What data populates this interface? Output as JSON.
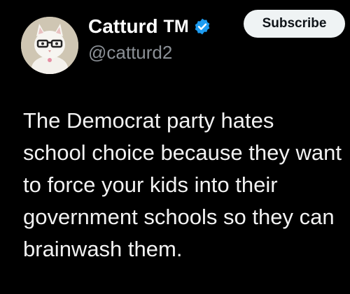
{
  "tweet": {
    "author": {
      "display_name": "Catturd",
      "badge_text": "TM",
      "handle": "@catturd2",
      "avatar_icon": "cat-with-glasses-avatar",
      "verified_icon": "verified-badge-icon",
      "verified_color": "#1d9bf0"
    },
    "subscribe_label": "Subscribe",
    "text": "The Democrat party hates school choice because they want to force your kids into their government schools so they can brainwash them."
  },
  "colors": {
    "background": "#000000",
    "text": "#e7e9ea",
    "handle": "#8b9096",
    "button_bg": "#eff3f4"
  }
}
